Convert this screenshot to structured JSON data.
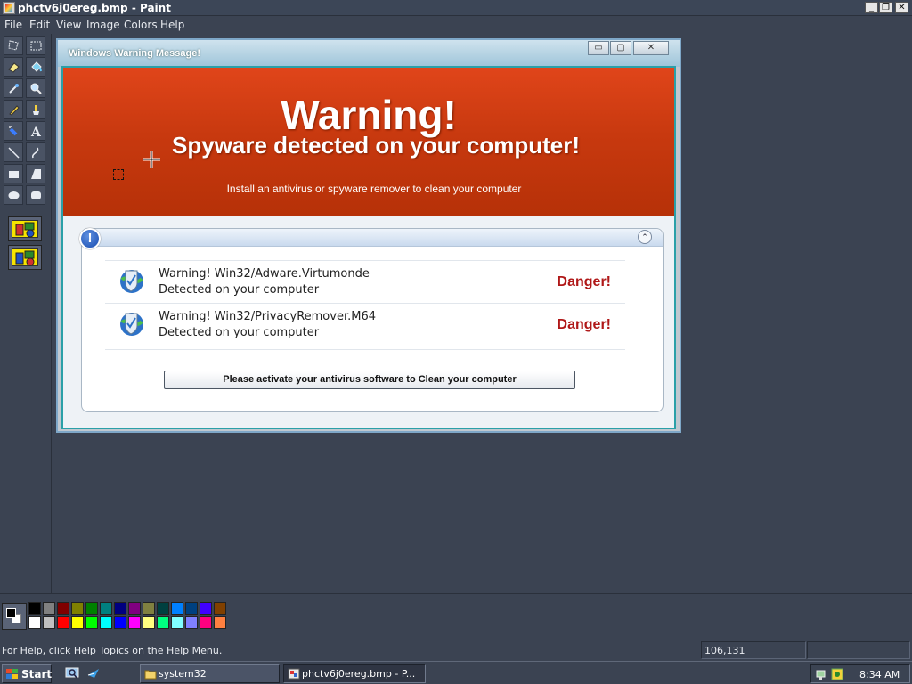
{
  "window": {
    "title": "phctv6j0ereg.bmp - Paint",
    "controls": {
      "minimize": "_",
      "maximize": "❐",
      "close": "✕"
    }
  },
  "menu": [
    "File",
    "Edit",
    "View",
    "Image",
    "Colors",
    "Help"
  ],
  "toolbox": {
    "tools": [
      "free-select",
      "select",
      "eraser",
      "fill",
      "color-picker",
      "magnifier",
      "pencil",
      "brush",
      "airbrush",
      "text",
      "line",
      "curve",
      "rectangle",
      "polygon",
      "ellipse",
      "rounded-rectangle"
    ]
  },
  "dialog": {
    "title": "Windows Warning Message!",
    "buttons": {
      "minimize": "▭",
      "restore": "▢",
      "close": "✕"
    },
    "banner": {
      "heading": "Warning!",
      "subheading": "Spyware detected on your computer!",
      "note": "Install an antivirus or spyware remover to clean your computer"
    },
    "panel": {
      "info_glyph": "!",
      "collapse_glyph": "⌃",
      "threats": [
        {
          "name": "Warning! Win32/Adware.Virtumonde",
          "detail": "Detected on your computer",
          "level": "Danger!"
        },
        {
          "name": "Warning! Win32/PrivacyRemover.M64",
          "detail": "Detected on your computer",
          "level": "Danger!"
        }
      ],
      "action_label": "Please activate your antivirus software to Clean your computer"
    }
  },
  "palette": {
    "foreground": "#000000",
    "background": "#ffffff",
    "colors_top": [
      "#000000",
      "#808080",
      "#800000",
      "#808000",
      "#008000",
      "#008080",
      "#000080",
      "#800080",
      "#808040",
      "#004040",
      "#0080ff",
      "#004080",
      "#4000ff",
      "#804000"
    ],
    "colors_bottom": [
      "#ffffff",
      "#c0c0c0",
      "#ff0000",
      "#ffff00",
      "#00ff00",
      "#00ffff",
      "#0000ff",
      "#ff00ff",
      "#ffff80",
      "#00ff80",
      "#80ffff",
      "#8080ff",
      "#ff0080",
      "#ff8040"
    ]
  },
  "status": {
    "help": "For Help, click Help Topics on the Help Menu.",
    "coords": "106,131"
  },
  "taskbar": {
    "start": "Start",
    "tasks": [
      {
        "label": "system32",
        "active": false
      },
      {
        "label": "phctv6j0ereg.bmp - P...",
        "active": true
      }
    ],
    "clock": "8:34 AM"
  },
  "colors": {
    "banner": "#c8390f",
    "danger_text": "#b01818",
    "dialog_frame": "#2aa0a8"
  }
}
